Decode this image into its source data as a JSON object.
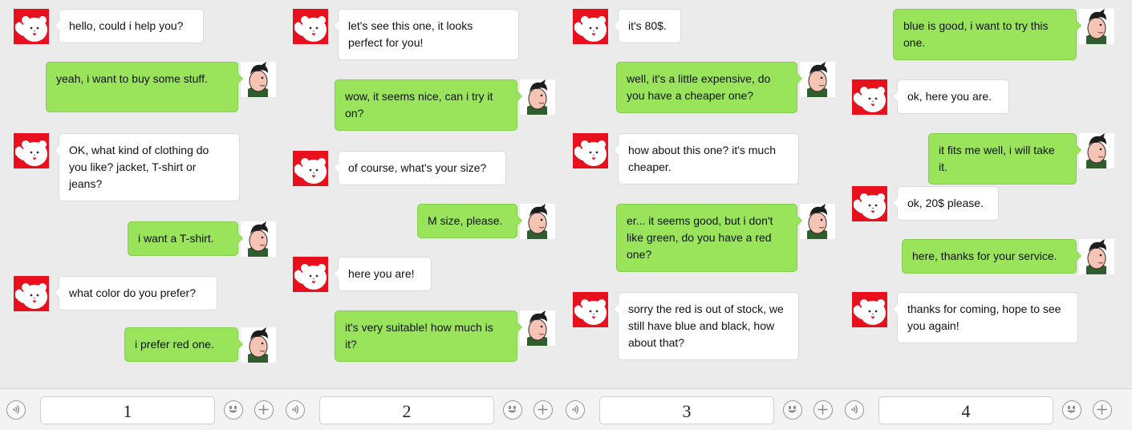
{
  "colors": {
    "background": "#ebebeb",
    "shop_bubble": "#ffffff",
    "customer_bubble": "#99e45b",
    "avatar_red": "#e8101c"
  },
  "icons": {
    "shop_avatar": "white-bear-avatar-icon",
    "customer_avatar": "boy-avatar-icon",
    "voice": "voice-icon",
    "emoji": "smiley-icon",
    "add": "plus-icon"
  },
  "conversations": [
    {
      "input_label": "1",
      "messages": [
        {
          "from": "shop",
          "text": "hello, could i help you?"
        },
        {
          "from": "customer",
          "text": "yeah, i want to buy some stuff."
        },
        {
          "from": "shop",
          "text": "OK, what kind of clothing do you like? jacket, T-shirt or jeans?"
        },
        {
          "from": "customer",
          "text": "i want a T-shirt."
        },
        {
          "from": "shop",
          "text": "what color do you prefer?"
        },
        {
          "from": "customer",
          "text": "i prefer red one."
        }
      ]
    },
    {
      "input_label": "2",
      "messages": [
        {
          "from": "shop",
          "text": "let's see this one, it looks perfect for you!"
        },
        {
          "from": "customer",
          "text": "wow, it seems nice, can i try it on?"
        },
        {
          "from": "shop",
          "text": "of course, what's your size?"
        },
        {
          "from": "customer",
          "text": "M size, please."
        },
        {
          "from": "shop",
          "text": "here you are!"
        },
        {
          "from": "customer",
          "text": "it's very suitable! how much is it?"
        }
      ]
    },
    {
      "input_label": "3",
      "messages": [
        {
          "from": "shop",
          "text": "it's 80$."
        },
        {
          "from": "customer",
          "text": "well, it's a little expensive, do you have a cheaper one?"
        },
        {
          "from": "shop",
          "text": "how about this one? it's much cheaper."
        },
        {
          "from": "customer",
          "text": "er... it seems good, but i don't like green, do you have a red one?"
        },
        {
          "from": "shop",
          "text": "sorry the red is out of stock, we still have blue and black, how about that?"
        }
      ]
    },
    {
      "input_label": "4",
      "messages": [
        {
          "from": "customer",
          "text": "blue is good, i want to try this one."
        },
        {
          "from": "shop",
          "text": "ok, here you are."
        },
        {
          "from": "customer",
          "text": "it fits me well, i will take it."
        },
        {
          "from": "shop",
          "text": "ok, 20$ please."
        },
        {
          "from": "customer",
          "text": "here, thanks for your service."
        },
        {
          "from": "shop",
          "text": "thanks for coming, hope to see you again!"
        }
      ]
    }
  ]
}
